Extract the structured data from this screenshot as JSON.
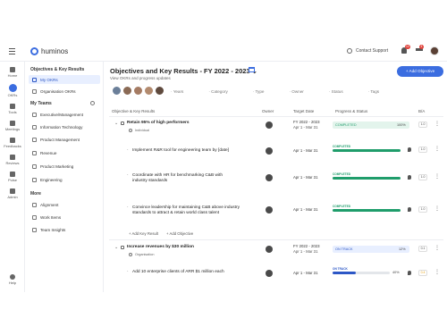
{
  "colors": {
    "accent": "#3b6de0",
    "completed": "#1f9d6b",
    "on_track": "#2c57c6",
    "warning": "#e6a317"
  },
  "topbar": {
    "app_name": "huminos",
    "support_label": "Contact Support",
    "bell_badge": "12",
    "grad_badge": "4"
  },
  "leftnav": {
    "items": [
      {
        "label": "Home",
        "icon": "home-icon"
      },
      {
        "label": "OKRs",
        "icon": "target-icon"
      },
      {
        "label": "Tools",
        "icon": "tools-icon"
      },
      {
        "label": "Meetings",
        "icon": "calendar-icon"
      },
      {
        "label": "Feedbacks",
        "icon": "feedback-icon"
      },
      {
        "label": "Reviews",
        "icon": "reviews-icon"
      },
      {
        "label": "Pulse",
        "icon": "pulse-icon"
      },
      {
        "label": "Admin",
        "icon": "gear-icon"
      }
    ],
    "help_label": "Help"
  },
  "sidebar": {
    "section1_title": "Objectives & Key Results",
    "my_okrs": "My OKRs",
    "org_okrs": "Organisation OKRs",
    "teams_title": "My Teams",
    "teams": [
      "Executive/Management",
      "Information Technology",
      "Product Management",
      "Revenue",
      "Product Marketing",
      "Engineering"
    ],
    "more_title": "More",
    "more": [
      "Alignment",
      "Work Items",
      "Team Insights"
    ]
  },
  "main": {
    "title": "Objectives and Key Results -  FY 2022 - 2023 ⌄",
    "subtitle": "View OKRs and progress updates",
    "add_button": "+ Add Objective",
    "filters": [
      "Years",
      "Category",
      "Type",
      "Owner",
      "Status",
      "Tags"
    ],
    "columns": {
      "okr": "Objective & Key Results",
      "owner": "Owner",
      "target": "Target Date",
      "progress": "Progress & Status",
      "ba": "B/A"
    },
    "objective1": {
      "title": "Retain 95% of high performers",
      "type": "Individual",
      "target": "FY 2022 - 2023",
      "target_range": "Apr 1 - Mar 31",
      "status": "COMPLETED",
      "percent": "100%",
      "score": "1.0"
    },
    "key_results1": [
      {
        "title": "Implement R&R tool for engineering team by [date]",
        "target": "Apr 1 - Mar 31",
        "status": "COMPLETED",
        "progress": 100,
        "score": "1.0"
      },
      {
        "title": "Coordinate with HR for benchmarking C&B with industry standards",
        "target": "Apr 1 - Mar 31",
        "status": "COMPLETED",
        "progress": 100,
        "score": "1.0"
      },
      {
        "title": "Convince leadership for maintaining C&B above industry standards to attract & retain world class talent",
        "target": "Apr 1 - Mar 31",
        "status": "COMPLETED",
        "progress": 100,
        "score": "1.0"
      }
    ],
    "add_kr": "+ Add Key Result",
    "add_obj_link": "+ Add Objective",
    "objective2": {
      "title": "Increase revenues by $30 million",
      "type": "Organisation",
      "target": "FY 2022 - 2023",
      "target_range": "Apr 1 - Mar 31",
      "status": "ON TRACK",
      "percent": "12%",
      "score": "0.1"
    },
    "key_results2": [
      {
        "title": "Add 10 enterprise clients of ARR $1 million each",
        "target": "Apr 1 - Mar 31",
        "status": "ON TRACK",
        "progress": 40,
        "percent_label": "40%",
        "score": "0.4"
      }
    ]
  }
}
